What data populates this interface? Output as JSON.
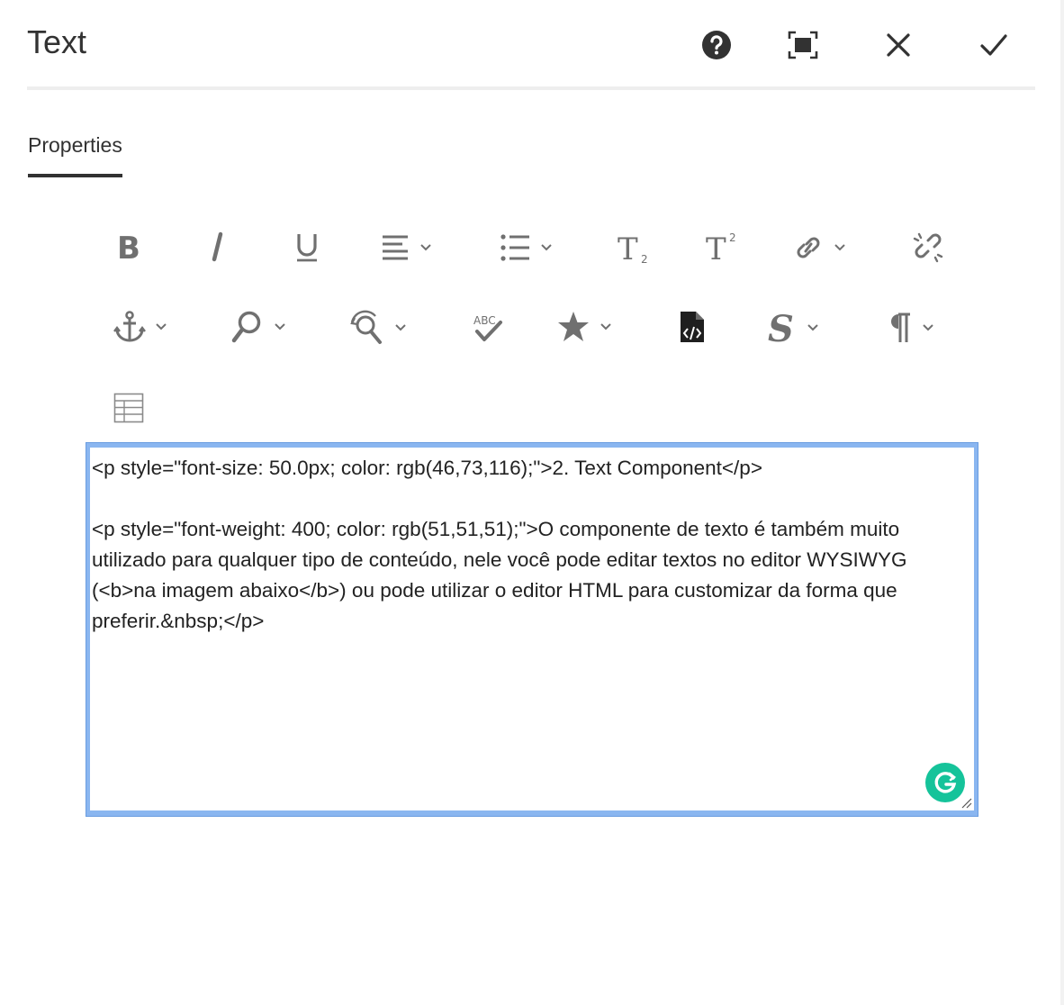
{
  "dialog": {
    "title": "Text",
    "actions": {
      "help": "help-icon",
      "fullscreen": "fullscreen-icon",
      "close": "close-icon",
      "done": "checkmark-icon"
    }
  },
  "tabs": [
    {
      "label": "Properties",
      "active": true
    }
  ],
  "toolbar": {
    "row1": [
      "bold-icon",
      "italic-icon",
      "underline-icon",
      "align-icon",
      "list-icon",
      "subscript-icon",
      "superscript-icon",
      "link-icon",
      "unlink-icon"
    ],
    "row2": [
      "anchor-icon",
      "find-icon",
      "replace-icon",
      "spellcheck-icon",
      "special-chars-icon",
      "source-edit-icon",
      "styles-icon",
      "paragraph-icon"
    ],
    "row3": [
      "table-icon"
    ],
    "labels": {
      "subscript": "T",
      "superscript": "T",
      "sub_mark": "2",
      "sup_mark": "2",
      "spell": "ABC"
    }
  },
  "editor": {
    "content": "<p style=\"font-size: 50.0px; color: rgb(46,73,116);\">2. Text Component</p>\n\n<p style=\"font-weight: 400; color: rgb(51,51,51);\">O componente de texto é também muito utilizado para qualquer tipo de conteúdo, nele você pode editar textos no editor WYSIWYG (<b>na imagem abaixo</b>) ou pode utilizar o editor HTML para customizar da forma que preferir.&nbsp;</p>",
    "grammarly_icon": "grammarly-icon"
  },
  "colors": {
    "icon": "#707070",
    "icon_dark": "#323232",
    "editor_border": "#8ab6f0",
    "grammarly": "#15c39a"
  }
}
